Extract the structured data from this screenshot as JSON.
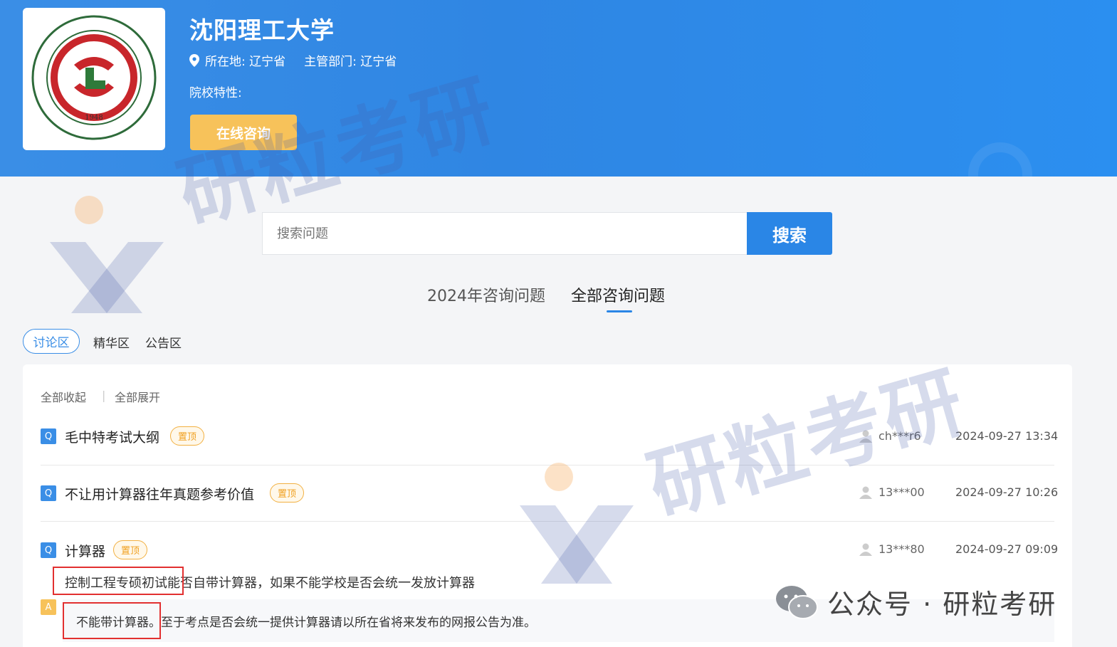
{
  "header": {
    "university_name": "沈阳理工大学",
    "location": "所在地: 辽宁省",
    "department": "主管部门: 辽宁省",
    "features": "院校特性:",
    "consult_button": "在线咨询",
    "logo_year": "1948",
    "logo_text": "SHENYANG LIGONG UNIVERSITY",
    "colors": {
      "banner": "#2f86e3",
      "consult": "#f7c25a"
    }
  },
  "search": {
    "placeholder": "搜索问题",
    "button": "搜索"
  },
  "main_tabs": [
    {
      "label": "2024年咨询问题",
      "active": false
    },
    {
      "label": "全部咨询问题",
      "active": true
    }
  ],
  "sub_tabs": [
    {
      "label": "讨论区",
      "active": true
    },
    {
      "label": "精华区",
      "active": false
    },
    {
      "label": "公告区",
      "active": false
    }
  ],
  "controls": {
    "collapse_all": "全部收起",
    "separator": "|",
    "expand_all": "全部展开"
  },
  "questions": [
    {
      "badge": "Q",
      "title": "毛中特考试大纲",
      "tag": "置顶",
      "user": "ch***r6",
      "date": "2024-09-27 13:34"
    },
    {
      "badge": "Q",
      "title": "不让用计算器往年真题参考价值",
      "tag": "置顶",
      "user": "13***00",
      "date": "2024-09-27 10:26"
    },
    {
      "badge": "Q",
      "title": "计算器",
      "tag": "置顶",
      "user": "13***80",
      "date": "2024-09-27 09:09",
      "detail": "控制工程专硕初试能否自带计算器，如果不能学校是否会统一发放计算器",
      "answer_badge": "A",
      "answer": "不能带计算器。至于考点是否会统一提供计算器请以所在省将来发布的网报公告为准。"
    }
  ],
  "watermark": {
    "text": "研粒考研",
    "official_account": "公众号 · 研粒考研"
  }
}
